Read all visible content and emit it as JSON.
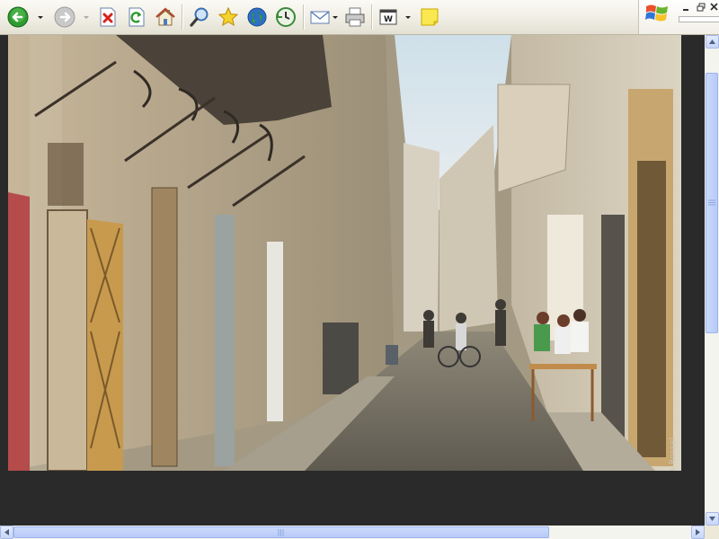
{
  "toolbar": {
    "buttons": [
      {
        "icon": "back-arrow-icon",
        "enabled": true
      },
      {
        "icon": "forward-arrow-icon",
        "enabled": false
      },
      {
        "icon": "stop-icon",
        "enabled": true
      },
      {
        "icon": "refresh-icon",
        "enabled": true
      },
      {
        "icon": "home-icon",
        "enabled": true
      },
      {
        "icon": "search-icon",
        "enabled": true
      },
      {
        "icon": "favorites-star-icon",
        "enabled": true
      },
      {
        "icon": "globe-media-icon",
        "enabled": true
      },
      {
        "icon": "history-icon",
        "enabled": true
      },
      {
        "icon": "mail-icon",
        "enabled": true
      },
      {
        "icon": "print-icon",
        "enabled": true
      },
      {
        "icon": "edit-word-icon",
        "enabled": true
      },
      {
        "icon": "sticky-note-icon",
        "enabled": true
      }
    ],
    "edit_label": "W"
  },
  "brand": {
    "logo": "windows-logo-icon"
  },
  "photo": {
    "subject": "narrow old-town street with shuttered doors, people gathered at the far end",
    "credit": "(c) Hans Rossel"
  },
  "colors": {
    "viewport_bg": "#2a2a2a",
    "toolbar_bg": "#f0eee4",
    "scroll_thumb": "#c1d3fb",
    "scroll_track": "#f4f4ee"
  },
  "scroll": {
    "vertical_position": 0.12,
    "horizontal_position": 0.0
  }
}
